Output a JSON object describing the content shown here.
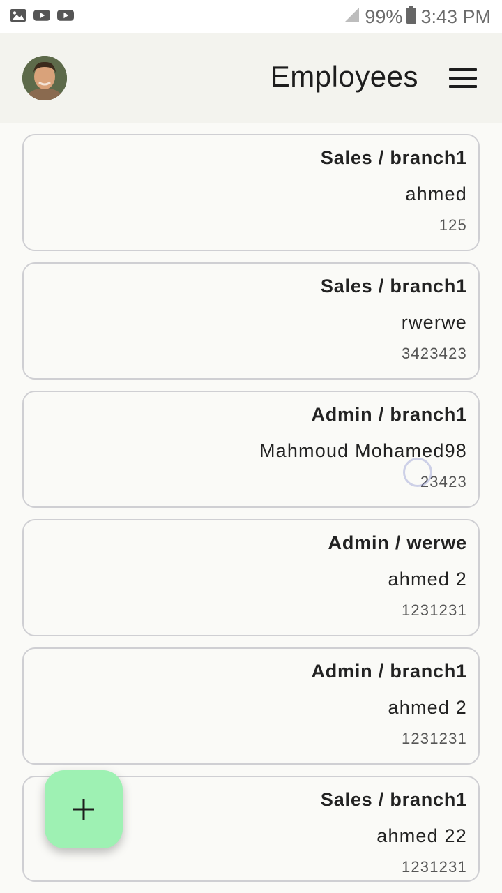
{
  "status_bar": {
    "left_icons": [
      "image-icon",
      "youtube-icon",
      "youtube-icon"
    ],
    "battery": "99%",
    "time": "3:43 PM"
  },
  "header": {
    "title": "Employees",
    "avatar_icon": "user-avatar",
    "menu_icon": "hamburger-menu-icon"
  },
  "employees": [
    {
      "dept_branch": "Sales / branch1",
      "name": "ahmed",
      "id": "125"
    },
    {
      "dept_branch": "Sales / branch1",
      "name": "rwerwe",
      "id": "3423423"
    },
    {
      "dept_branch": "Admin / branch1",
      "name": "Mahmoud Mohamed98",
      "id": "23423"
    },
    {
      "dept_branch": "Admin / werwe",
      "name": "ahmed 2",
      "id": "1231231"
    },
    {
      "dept_branch": "Admin / branch1",
      "name": "ahmed 2",
      "id": "1231231"
    },
    {
      "dept_branch": "Sales / branch1",
      "name": "ahmed 22",
      "id": "1231231"
    }
  ],
  "fab": {
    "icon": "plus-icon",
    "color": "#9ef1b3"
  }
}
